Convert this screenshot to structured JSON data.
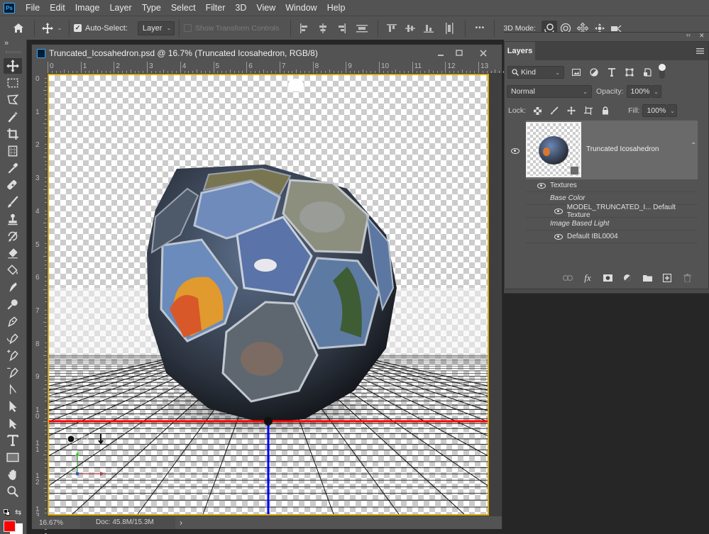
{
  "app": {
    "logo": "Ps",
    "menu": [
      "File",
      "Edit",
      "Image",
      "Layer",
      "Type",
      "Select",
      "Filter",
      "3D",
      "View",
      "Window",
      "Help"
    ]
  },
  "options_bar": {
    "home_icon": "home-icon",
    "move_icon": "move-icon",
    "auto_select_label": "Auto-Select:",
    "auto_select_checked": true,
    "auto_select_target": "Layer",
    "show_transform_label": "Show Transform Controls",
    "show_transform_checked": false,
    "more_label": "•••",
    "mode_3d_label": "3D Mode:",
    "mode_3d_icons": [
      "orbit-icon",
      "roll-icon",
      "pan-icon",
      "slide-icon",
      "camera-zoom-icon"
    ]
  },
  "toolbar": {
    "collapse_label": "»",
    "tools": [
      "move",
      "marquee",
      "lasso",
      "magic-wand",
      "crop",
      "perspective-crop",
      "eyedropper",
      "healing",
      "brush",
      "clone-stamp",
      "history-brush",
      "eraser",
      "paint-bucket",
      "smudge",
      "dodge",
      "pen",
      "freeform-pen",
      "add-anchor",
      "delete-anchor",
      "convert-point",
      "path-selection",
      "direct-selection",
      "type",
      "rectangle",
      "hand",
      "zoom"
    ],
    "foreground_color": "#ff0000",
    "background_color": "#ffffff"
  },
  "document": {
    "title": "Truncated_Icosahedron.psd @ 16.7% (Truncated Icosahedron, RGB/8)",
    "h_ruler": [
      "0",
      "1",
      "2",
      "3",
      "4",
      "5",
      "6",
      "7",
      "8",
      "9",
      "10",
      "11",
      "12",
      "13"
    ],
    "v_ruler": [
      "0",
      "1",
      "2",
      "3",
      "4",
      "5",
      "6",
      "7",
      "8",
      "9",
      "10",
      "11",
      "12",
      "13"
    ],
    "zoom": "16.67%",
    "doc_info": "Doc: 45.8M/15.3M",
    "status_arrow": "›",
    "canvas_border_color": "#d8a90f",
    "ground_axis_colors": {
      "x": "#ff0000",
      "z": "#0000ff",
      "y": "#00aa00"
    }
  },
  "panels": {
    "collapse_label": "‹‹",
    "close_label": "✕",
    "layers": {
      "tab_label": "Layers",
      "filter_kind": "Kind",
      "filter_icons": [
        "image-filter-icon",
        "adjustment-filter-icon",
        "type-filter-icon",
        "shape-filter-icon",
        "smart-object-filter-icon"
      ],
      "blend_mode": "Normal",
      "opacity_label": "Opacity:",
      "opacity_value": "100%",
      "lock_label": "Lock:",
      "fill_label": "Fill:",
      "fill_value": "100%",
      "layer": {
        "name": "Truncated Icosahedron",
        "visible": true,
        "type": "3D"
      },
      "sublayers": [
        {
          "label": "Textures",
          "kind": "group",
          "eye": true
        },
        {
          "label": "Base Color",
          "kind": "heading",
          "eye": false
        },
        {
          "label": "MODEL_TRUNCATED_I... Default Texture",
          "kind": "item",
          "eye": true
        },
        {
          "label": "Image Based Light",
          "kind": "heading",
          "eye": false
        },
        {
          "label": "Default IBL0004",
          "kind": "item",
          "eye": true
        }
      ],
      "footer_icons": [
        "link-icon",
        "fx-icon",
        "mask-icon",
        "adjustment-icon",
        "folder-icon",
        "new-layer-icon",
        "trash-icon"
      ],
      "footer_fx_label": "fx"
    }
  }
}
